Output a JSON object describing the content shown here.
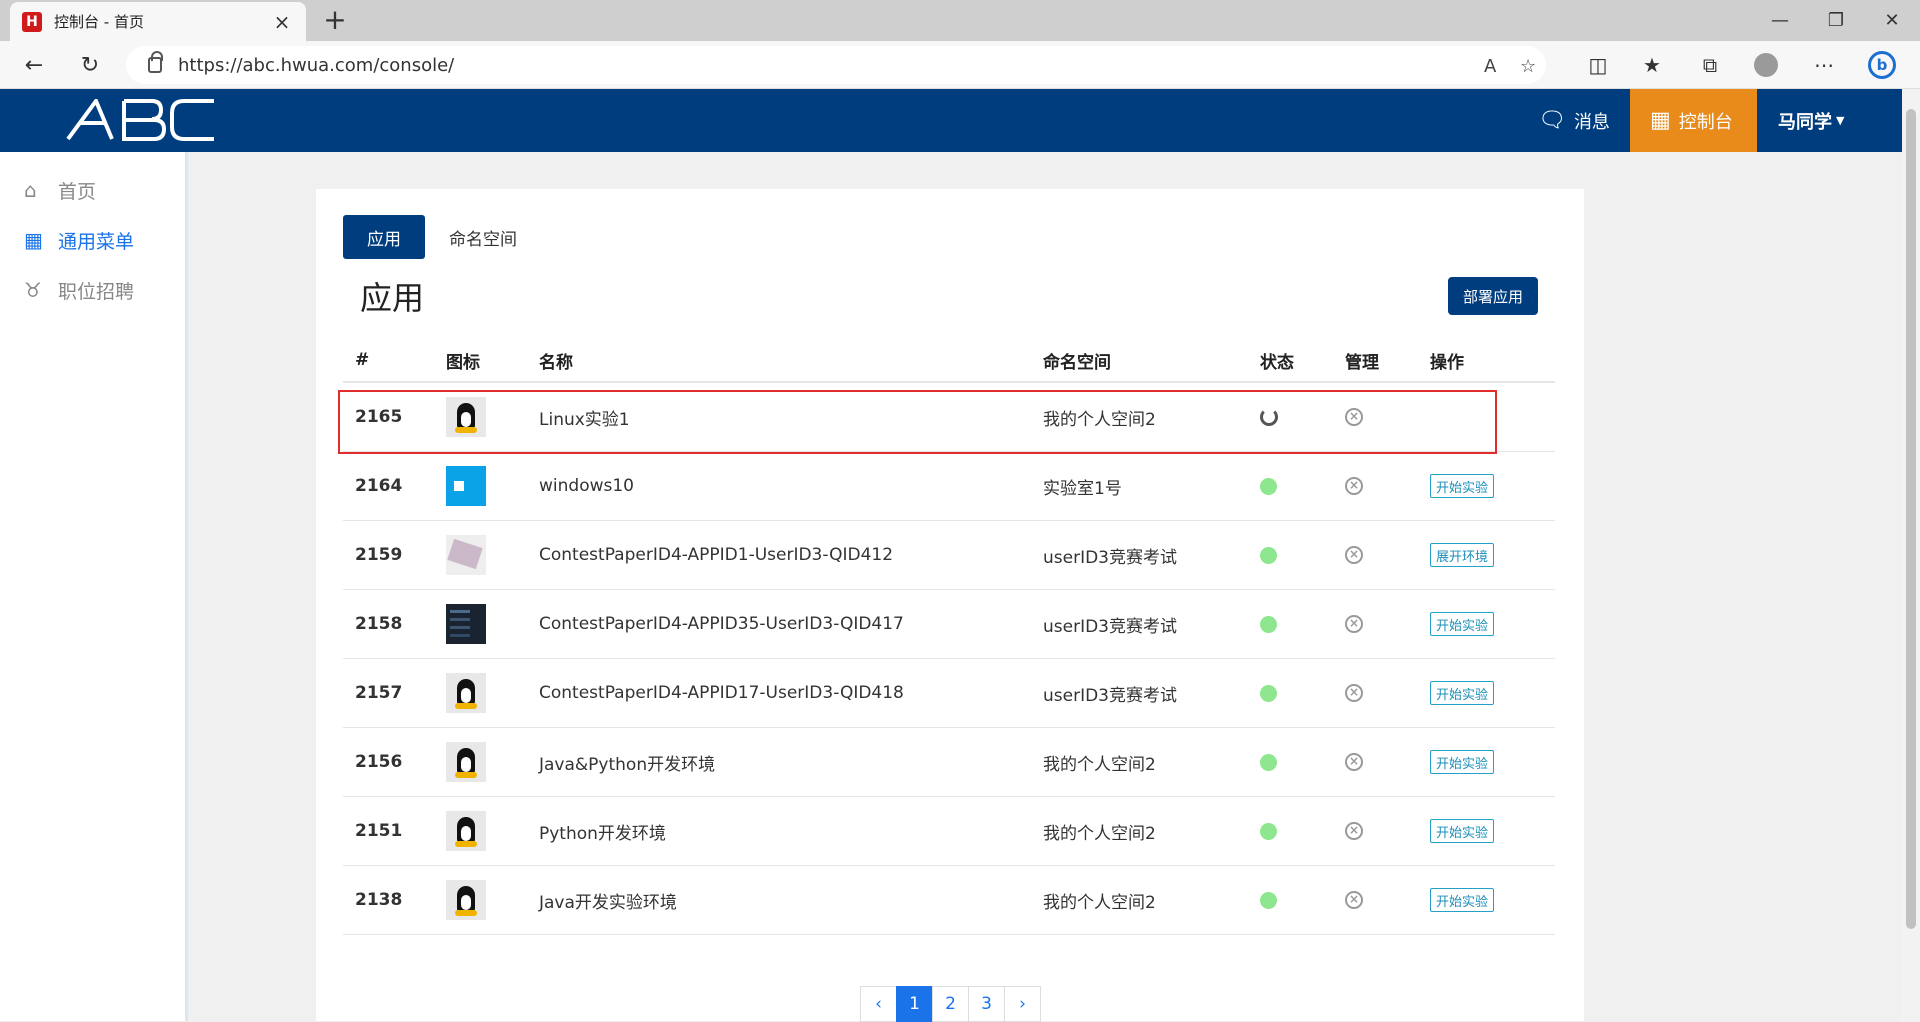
{
  "browser": {
    "tab_title": "控制台 - 首页",
    "tab_favicon": "H",
    "url": "https://abc.hwua.com/console/"
  },
  "header": {
    "logo_text": "ABC",
    "messages_label": "消息",
    "console_label": "控制台",
    "user_label": "马同学"
  },
  "sidebar": {
    "items": [
      {
        "label": "首页",
        "icon": "home-icon"
      },
      {
        "label": "通用菜单",
        "icon": "grid-icon",
        "active": true
      },
      {
        "label": "职位招聘",
        "icon": "tie-icon"
      }
    ]
  },
  "main": {
    "tabs": [
      {
        "label": "应用",
        "active": true
      },
      {
        "label": "命名空间"
      }
    ],
    "section_title": "应用",
    "deploy_button": "部署应用",
    "columns": [
      "#",
      "图标",
      "名称",
      "命名空间",
      "状态",
      "管理",
      "操作"
    ],
    "rows": [
      {
        "id": "2165",
        "icon": "linux-icon",
        "name": "Linux实验1",
        "namespace": "我的个人空间2",
        "status": "loading",
        "action": ""
      },
      {
        "id": "2164",
        "icon": "windows-icon",
        "name": "windows10",
        "namespace": "实验室1号",
        "status": "running",
        "action": "开始实验"
      },
      {
        "id": "2159",
        "icon": "screenshot-icon",
        "name": "ContestPaperID4-APPID1-UserID3-QID412",
        "namespace": "userID3竞赛考试",
        "status": "running",
        "action": "展开环境"
      },
      {
        "id": "2158",
        "icon": "terminal-icon",
        "name": "ContestPaperID4-APPID35-UserID3-QID417",
        "namespace": "userID3竞赛考试",
        "status": "running",
        "action": "开始实验"
      },
      {
        "id": "2157",
        "icon": "linux-icon",
        "name": "ContestPaperID4-APPID17-UserID3-QID418",
        "namespace": "userID3竞赛考试",
        "status": "running",
        "action": "开始实验"
      },
      {
        "id": "2156",
        "icon": "linux-icon",
        "name": "Java&Python开发环境",
        "namespace": "我的个人空间2",
        "status": "running",
        "action": "开始实验"
      },
      {
        "id": "2151",
        "icon": "linux-icon",
        "name": "Python开发环境",
        "namespace": "我的个人空间2",
        "status": "running",
        "action": "开始实验"
      },
      {
        "id": "2138",
        "icon": "linux-icon",
        "name": "Java开发实验环境",
        "namespace": "我的个人空间2",
        "status": "running",
        "action": "开始实验"
      }
    ],
    "pagination": {
      "prev": "‹",
      "pages": [
        "1",
        "2",
        "3"
      ],
      "current": "1",
      "next": "›"
    }
  },
  "colors": {
    "brand": "#003d7e",
    "console_accent": "#e88b1a",
    "status_running": "#8ee68e",
    "highlight": "#e02c2c"
  }
}
